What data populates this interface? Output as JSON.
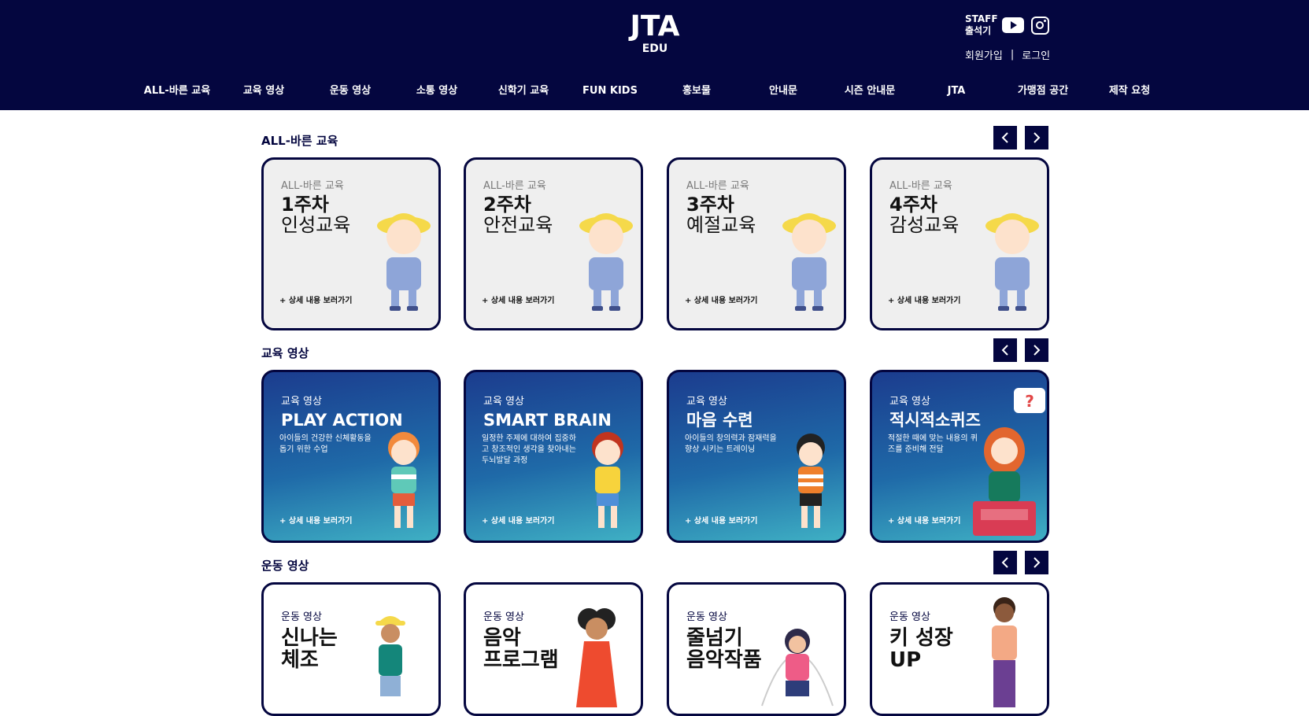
{
  "header": {
    "logo_main": "JTA",
    "logo_sub": "EDU",
    "staff_line1": "STAFF",
    "staff_line2": "출석기",
    "signup": "회원가입",
    "divider": "|",
    "login": "로그인"
  },
  "nav": [
    "ALL-바른 교육",
    "교육 영상",
    "운동 영상",
    "소통 영상",
    "신학기 교육",
    "FUN KIDS",
    "홍보물",
    "안내문",
    "시즌 안내문",
    "JTA",
    "가맹점 공간",
    "제작 요청"
  ],
  "sections": [
    {
      "title": "ALL-바른 교육",
      "cards": [
        {
          "small": "ALL-바른 교육",
          "line1": "1주차",
          "line2": "인성교육",
          "more": "+ 상세 내용 보러가기"
        },
        {
          "small": "ALL-바른 교육",
          "line1": "2주차",
          "line2": "안전교육",
          "more": "+ 상세 내용 보러가기"
        },
        {
          "small": "ALL-바른 교육",
          "line1": "3주차",
          "line2": "예절교육",
          "more": "+ 상세 내용 보러가기"
        },
        {
          "small": "ALL-바른 교육",
          "line1": "4주차",
          "line2": "감성교육",
          "more": "+ 상세 내용 보러가기"
        }
      ]
    },
    {
      "title": "교육 영상",
      "cards": [
        {
          "small": "교육 영상",
          "line1": "PLAY ACTION",
          "desc": "아이들의 건강한 신체활동을 돕기 위한 수업",
          "more": "+ 상세 내용 보러가기"
        },
        {
          "small": "교육 영상",
          "line1": "SMART BRAIN",
          "desc": "일정한 주제에 대하여 집중하고 창조적인 생각을 찾아내는 두뇌발달 과정",
          "more": "+ 상세 내용 보러가기"
        },
        {
          "small": "교육 영상",
          "line1": "마음 수련",
          "desc": "아이들의 창의력과 잠재력을 향상 시키는 트레이닝",
          "more": "+ 상세 내용 보러가기"
        },
        {
          "small": "교육 영상",
          "line1": "적시적소퀴즈",
          "desc": "적절한 때에 맞는 내용의 퀴즈를 준비해 전달",
          "more": "+ 상세 내용 보러가기"
        }
      ]
    },
    {
      "title": "운동 영상",
      "cards": [
        {
          "small": "운동 영상",
          "line1": "신나는",
          "line2": "체조"
        },
        {
          "small": "운동 영상",
          "line1": "음악",
          "line2": "프로그램"
        },
        {
          "small": "운동 영상",
          "line1": "줄넘기",
          "line2": "음악작품"
        },
        {
          "small": "운동 영상",
          "line1": "키 성장",
          "line2": "UP"
        }
      ]
    }
  ],
  "icons": {
    "youtube": "youtube-icon",
    "instagram": "instagram-icon",
    "prev": "chevron-left-icon",
    "next": "chevron-right-icon"
  },
  "colors": {
    "navy": "#04063f",
    "card_light": "#efefef",
    "hat_yellow": "#f5d94a"
  }
}
